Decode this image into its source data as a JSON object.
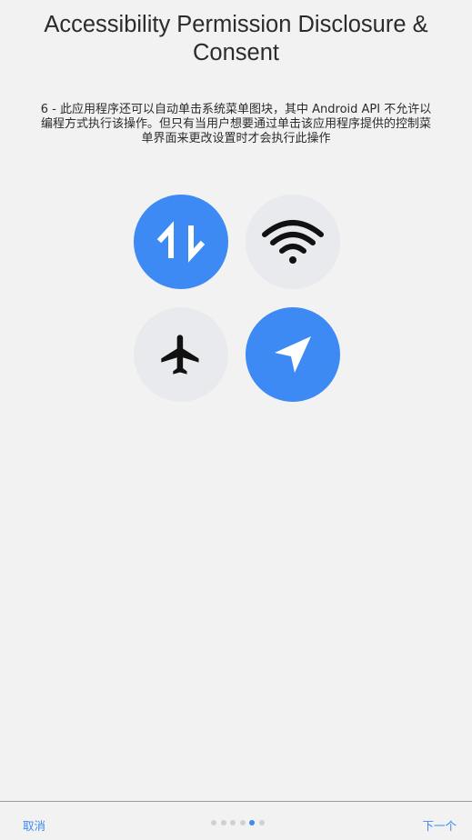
{
  "header": {
    "title": "Accessibility Permission Disclosure & Consent"
  },
  "description": "6 - 此应用程序还可以自动单击系统菜单图块，其中 Android API 不允许以编程方式执行该操作。但只有当用户想要通过单击该应用程序提供的控制菜单界面来更改设置时才会执行此操作",
  "tiles": [
    {
      "icon": "mobile-data-icon",
      "state": "on"
    },
    {
      "icon": "wifi-icon",
      "state": "off"
    },
    {
      "icon": "airplane-icon",
      "state": "off"
    },
    {
      "icon": "location-icon",
      "state": "on"
    }
  ],
  "colors": {
    "accent": "#3d8af5",
    "tile_off": "#e9eaee",
    "background": "#f2f2f2",
    "dot_inactive": "#cfd0d4"
  },
  "footer": {
    "cancel_label": "取消",
    "next_label": "下一个",
    "page_count": 6,
    "current_page": 5
  }
}
